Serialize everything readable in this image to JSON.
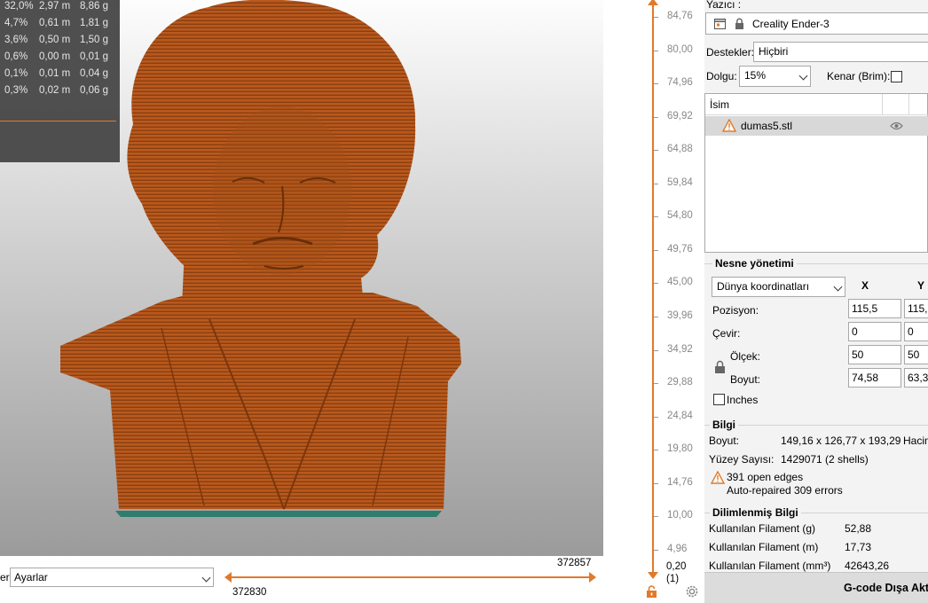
{
  "stats": {
    "rows": [
      {
        "pct": "32,0%",
        "m": "2,97 m",
        "g": "8,86 g"
      },
      {
        "pct": "4,7%",
        "m": "0,61 m",
        "g": "1,81 g"
      },
      {
        "pct": "3,6%",
        "m": "0,50 m",
        "g": "1,50 g"
      },
      {
        "pct": "0,6%",
        "m": "0,00 m",
        "g": "0,01 g"
      },
      {
        "pct": "0,1%",
        "m": "0,01 m",
        "g": "0,04 g"
      },
      {
        "pct": "0,3%",
        "m": "0,02 m",
        "g": "0,06 g"
      }
    ]
  },
  "bottom": {
    "settings_label_fragment": "er",
    "settings_value": "Ayarlar",
    "layer_right": "372857",
    "layer_left": "372830"
  },
  "height_slider": {
    "ticks": [
      "84,76",
      "80,00",
      "74,96",
      "69,92",
      "64,88",
      "59,84",
      "54,80",
      "49,76",
      "45,00",
      "39,96",
      "34,92",
      "29,88",
      "24,84",
      "19,80",
      "14,76",
      "10,00",
      "4,96"
    ],
    "current_value": "0,20",
    "current_layer": "(1)"
  },
  "panel": {
    "printer_label": "Yazıcı :",
    "printer_value": "Creality Ender-3",
    "supports_label": "Destekler:",
    "supports_value": "Hiçbiri",
    "infill_label": "Dolgu:",
    "infill_value": "15%",
    "brim_label": "Kenar (Brim):",
    "brim_checked": false,
    "list_header_name": "İsim",
    "object_name": "dumas5.stl",
    "object_manipulation": {
      "title": "Nesne yönetimi",
      "coord_system": "Dünya koordinatları",
      "col_x": "X",
      "col_y": "Y",
      "position_label": "Pozisyon:",
      "rotate_label": "Çevir:",
      "scale_label": "Ölçek:",
      "size_label": "Boyut:",
      "inches_label": "Inches",
      "position_x": "115,5",
      "position_y": "115,",
      "rotate_x": "0",
      "rotate_y": "0",
      "scale_x": "50",
      "scale_y": "50",
      "size_x": "74,58",
      "size_y": "63,3"
    },
    "info": {
      "title": "Bilgi",
      "size_label": "Boyut:",
      "size_value": "149,16 x 126,77 x 193,29",
      "volume_label_fragment": "Hacim",
      "facets_label": "Yüzey Sayısı:",
      "facets_value": "1429071 (2 shells)",
      "warning1": "391 open edges",
      "warning2": "Auto-repaired 309 errors"
    },
    "sliced_info": {
      "title": "Dilimlenmiş Bilgi",
      "filament_g_label": "Kullanılan Filament (g)",
      "filament_g_value": "52,88",
      "filament_m_label": "Kullanılan Filament (m)",
      "filament_m_value": "17,73",
      "filament_mm3_label": "Kullanılan Filament (mm³)",
      "filament_mm3_value": "42643,26"
    },
    "export_button": "G-code Dışa Aktar"
  },
  "colors": {
    "accent": "#e07a2a",
    "model": "#b7581e",
    "bed_edge": "#2a7a6a"
  }
}
